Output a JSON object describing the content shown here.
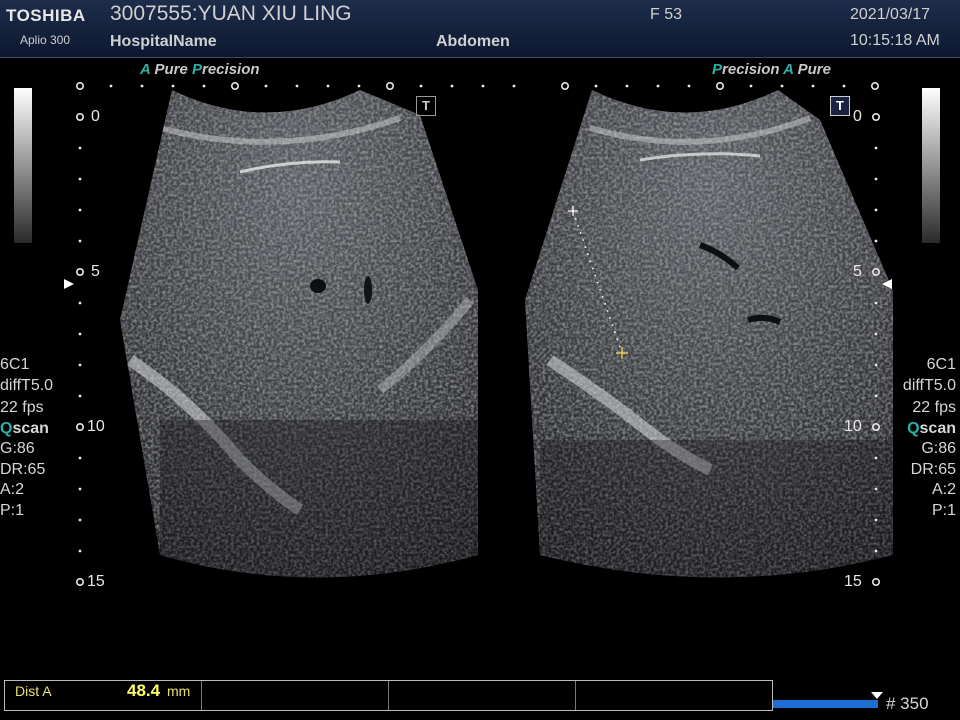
{
  "header": {
    "brand": "TOSHIBA",
    "model": "Aplio 300",
    "patient": "3007555:YUAN XIU LING",
    "hospital": "HospitalName",
    "exam": "Abdomen",
    "sex_age": "F  53",
    "date": "2021/03/17",
    "time": "10:15:18 AM"
  },
  "left_image": {
    "label_a": "A",
    "label_pure": "Pure",
    "label_p": "P",
    "label_precision": "recision",
    "depth_marks": [
      "0",
      "5",
      "10",
      "15"
    ]
  },
  "right_image": {
    "label_p": "P",
    "label_precision": "recision",
    "label_a": "A",
    "label_pure": "Pure",
    "depth_marks": [
      "0",
      "5",
      "10",
      "15"
    ]
  },
  "params": {
    "probe": "6C1",
    "filter": "diffT5.0",
    "fps": "22 fps",
    "qscan_q": "Q",
    "qscan_rest": "scan",
    "gain": "G:86",
    "dr": "DR:65",
    "a": "A:2",
    "p": "P:1"
  },
  "measurement": {
    "label": "Dist A",
    "value": "48.4",
    "unit": "mm"
  },
  "cine": {
    "frame_count": "# 350",
    "position": 0.95
  },
  "colors": {
    "header_bg": "#14223d",
    "accent_teal": "#2bb0a8",
    "measure_yellow": "#ffff66",
    "cine_blue": "#1a6fd0"
  }
}
